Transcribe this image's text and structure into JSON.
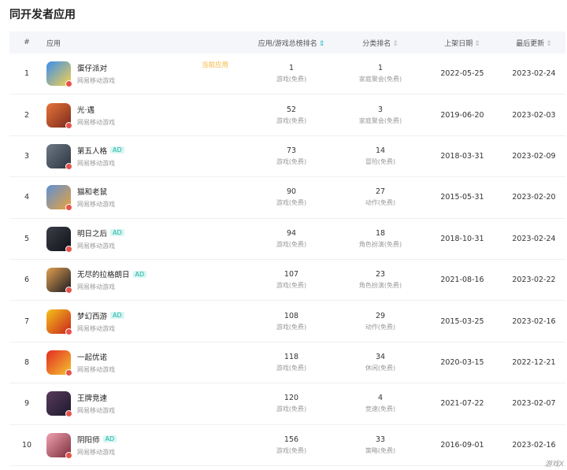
{
  "title": "同开发者应用",
  "headers": {
    "num": "#",
    "app": "应用",
    "rank": "应用/游戏总榜排名",
    "category": "分类排名",
    "release": "上架日期",
    "update": "最后更新",
    "sort_mark": "⇕"
  },
  "current_label": "当前应用",
  "ad_label": "AD",
  "watermark": "游戏X",
  "rows": [
    {
      "num": "1",
      "name": "蛋仔派对",
      "publisher": "网易移动游戏",
      "current": true,
      "ad": false,
      "rank": "1",
      "rank_cat": "游戏(免费)",
      "cat_rank": "1",
      "cat": "家庭聚会(免费)",
      "release": "2022-05-25",
      "update": "2023-02-24",
      "colors": [
        "#3a8ef0",
        "#f7d24a"
      ]
    },
    {
      "num": "2",
      "name": "光·遇",
      "publisher": "网易移动游戏",
      "current": false,
      "ad": false,
      "rank": "52",
      "rank_cat": "游戏(免费)",
      "cat_rank": "3",
      "cat": "家庭聚会(免费)",
      "release": "2019-06-20",
      "update": "2023-02-03",
      "colors": [
        "#e8743a",
        "#7a2a1c"
      ]
    },
    {
      "num": "3",
      "name": "第五人格",
      "publisher": "网易移动游戏",
      "current": false,
      "ad": true,
      "rank": "73",
      "rank_cat": "游戏(免费)",
      "cat_rank": "14",
      "cat": "冒险(免费)",
      "release": "2018-03-31",
      "update": "2023-02-09",
      "colors": [
        "#6d7a86",
        "#2c3340"
      ]
    },
    {
      "num": "4",
      "name": "猫和老鼠",
      "publisher": "网易移动游戏",
      "current": false,
      "ad": false,
      "rank": "90",
      "rank_cat": "游戏(免费)",
      "cat_rank": "27",
      "cat": "动作(免费)",
      "release": "2015-05-31",
      "update": "2023-02-20",
      "colors": [
        "#5f8fd6",
        "#e8a33a"
      ]
    },
    {
      "num": "5",
      "name": "明日之后",
      "publisher": "网易移动游戏",
      "current": false,
      "ad": true,
      "rank": "94",
      "rank_cat": "游戏(免费)",
      "cat_rank": "18",
      "cat": "角色扮演(免费)",
      "release": "2018-10-31",
      "update": "2023-02-24",
      "colors": [
        "#3b3e48",
        "#101218"
      ]
    },
    {
      "num": "6",
      "name": "无尽的拉格朗日",
      "publisher": "网易移动游戏",
      "current": false,
      "ad": true,
      "rank": "107",
      "rank_cat": "游戏(免费)",
      "cat_rank": "23",
      "cat": "角色扮演(免费)",
      "release": "2021-08-16",
      "update": "2023-02-22",
      "colors": [
        "#e0a050",
        "#1a1a22"
      ]
    },
    {
      "num": "7",
      "name": "梦幻西游",
      "publisher": "网易移动游戏",
      "current": false,
      "ad": true,
      "rank": "108",
      "rank_cat": "游戏(免费)",
      "cat_rank": "29",
      "cat": "动作(免费)",
      "release": "2015-03-25",
      "update": "2023-02-16",
      "colors": [
        "#f5c21b",
        "#c9241c"
      ]
    },
    {
      "num": "8",
      "name": "一起优诺",
      "publisher": "网易移动游戏",
      "current": false,
      "ad": false,
      "rank": "118",
      "rank_cat": "游戏(免费)",
      "cat_rank": "34",
      "cat": "休闲(免费)",
      "release": "2020-03-15",
      "update": "2022-12-21",
      "colors": [
        "#e42a22",
        "#f3c630"
      ]
    },
    {
      "num": "9",
      "name": "王牌竞速",
      "publisher": "网易移动游戏",
      "current": false,
      "ad": false,
      "rank": "120",
      "rank_cat": "游戏(免费)",
      "cat_rank": "4",
      "cat": "竞速(免费)",
      "release": "2021-07-22",
      "update": "2023-02-07",
      "colors": [
        "#5a3a5c",
        "#1c1a2e"
      ]
    },
    {
      "num": "10",
      "name": "阴阳师",
      "publisher": "网易移动游戏",
      "current": false,
      "ad": true,
      "rank": "156",
      "rank_cat": "游戏(免费)",
      "cat_rank": "33",
      "cat": "策略(免费)",
      "release": "2016-09-01",
      "update": "2023-02-16",
      "colors": [
        "#f1a1b0",
        "#7a2e3c"
      ]
    }
  ]
}
